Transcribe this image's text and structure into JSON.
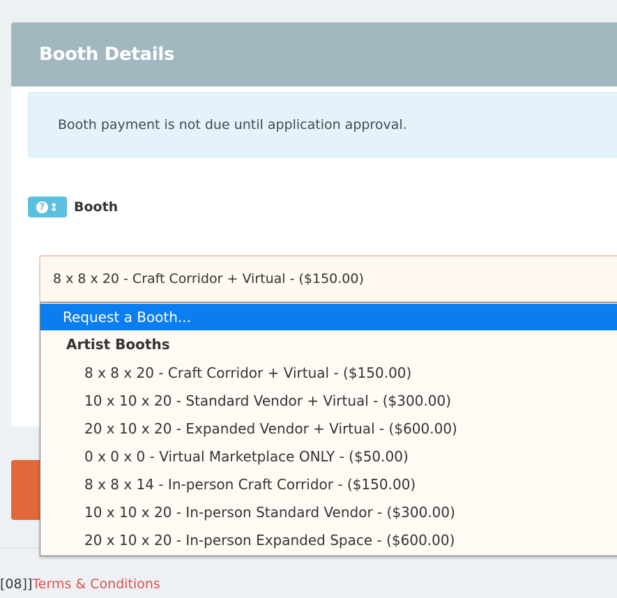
{
  "panel": {
    "title": "Booth Details",
    "alert_text": "Booth payment is not due until application approval."
  },
  "field": {
    "help_icon_label": "?",
    "help_icon_arrow": "↕",
    "label": "Booth",
    "selected_value": "8 x 8 x 20 - Craft Corridor + Virtual - ($150.00)"
  },
  "dropdown": {
    "highlighted": "Request a Booth...",
    "group_label": "Artist Booths",
    "options": [
      "8 x 8 x 20 - Craft Corridor + Virtual - ($150.00)",
      "10 x 10 x 20 - Standard Vendor + Virtual - ($300.00)",
      "20 x 10 x 20 - Expanded Vendor + Virtual - ($600.00)",
      "0 x 0 x 0 - Virtual Marketplace ONLY - ($50.00)",
      "8 x 8 x 14 - In-person Craft Corridor - ($150.00)",
      "10 x 10 x 20 - In-person Standard Vendor - ($300.00)",
      "20 x 10 x 20 - In-person Expanded Space - ($600.00)"
    ]
  },
  "footer": {
    "prefix": "[08]]",
    "link": "Terms & Conditions"
  },
  "colors": {
    "header_bg": "#a2b8c1",
    "alert_bg": "#e3f3f9",
    "highlight": "#0a7ef0",
    "accent_button": "#e2673a",
    "link": "#d9534f"
  }
}
